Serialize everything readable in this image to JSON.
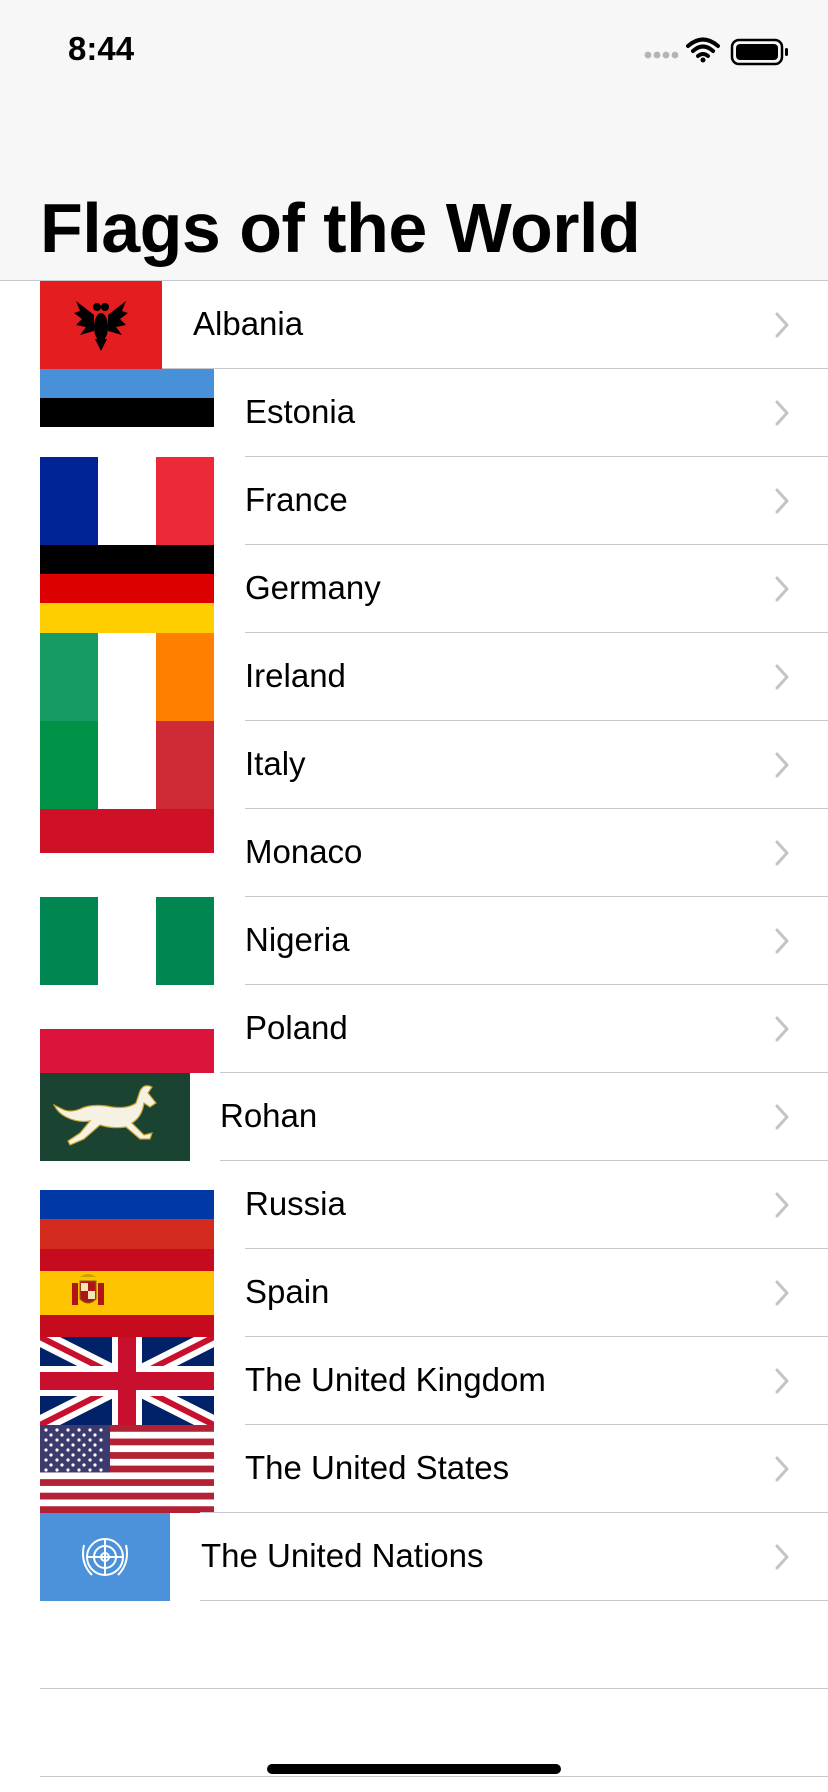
{
  "status_bar": {
    "time": "8:44",
    "icons": [
      "signal-icon",
      "wifi-icon",
      "battery-icon"
    ]
  },
  "navigation": {
    "title": "Flags of the World"
  },
  "countries": [
    {
      "name": "Albania",
      "flag": "albania-flag"
    },
    {
      "name": "Estonia",
      "flag": "estonia-flag"
    },
    {
      "name": "France",
      "flag": "france-flag"
    },
    {
      "name": "Germany",
      "flag": "germany-flag"
    },
    {
      "name": "Ireland",
      "flag": "ireland-flag"
    },
    {
      "name": "Italy",
      "flag": "italy-flag"
    },
    {
      "name": "Monaco",
      "flag": "monaco-flag"
    },
    {
      "name": "Nigeria",
      "flag": "nigeria-flag"
    },
    {
      "name": "Poland",
      "flag": "poland-flag"
    },
    {
      "name": "Rohan",
      "flag": "rohan-flag"
    },
    {
      "name": "Russia",
      "flag": "russia-flag"
    },
    {
      "name": "Spain",
      "flag": "spain-flag"
    },
    {
      "name": "The United Kingdom",
      "flag": "united-kingdom-flag"
    },
    {
      "name": "The United States",
      "flag": "united-states-flag"
    },
    {
      "name": "The United Nations",
      "flag": "united-nations-flag"
    }
  ],
  "colors": {
    "separator": "#c8c7cc",
    "chevron": "#c4c4c7",
    "header_bg": "#f7f7f7"
  }
}
